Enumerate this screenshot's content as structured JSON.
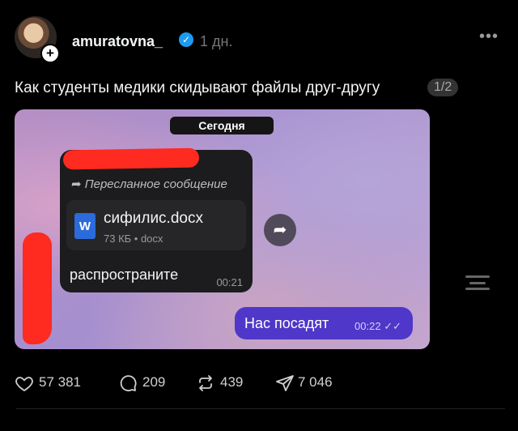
{
  "post": {
    "username": "amuratovna_",
    "time": "1 дн.",
    "more_label": "•••",
    "caption": "Как студенты медики скидывают файлы друг-другу",
    "page_indicator": "1/2"
  },
  "media": {
    "date_label": "Сегодня",
    "forwarded_label": "Пересланное сообщение",
    "file": {
      "icon_letter": "W",
      "name": "сифилис.docx",
      "meta": "73 КБ • docx"
    },
    "incoming": {
      "text": "распространите",
      "time": "00:21"
    },
    "outgoing": {
      "text": "Нас посадят",
      "time": "00:22"
    }
  },
  "actions": {
    "likes": "57 381",
    "comments": "209",
    "reposts": "439",
    "shares": "7 046"
  },
  "colors": {
    "background": "#000000",
    "verified": "#1d9bf0",
    "outgoing_bubble": "#4f37c9",
    "incoming_bubble": "#1c1c1e",
    "redaction": "#ff2a20"
  },
  "icons": [
    "plus-icon",
    "verified-icon",
    "more-icon",
    "forward-arrow-icon",
    "word-doc-icon",
    "share-arrow-icon",
    "double-check-icon",
    "menu-lines-icon",
    "heart-icon",
    "comment-icon",
    "repost-icon",
    "send-icon"
  ]
}
